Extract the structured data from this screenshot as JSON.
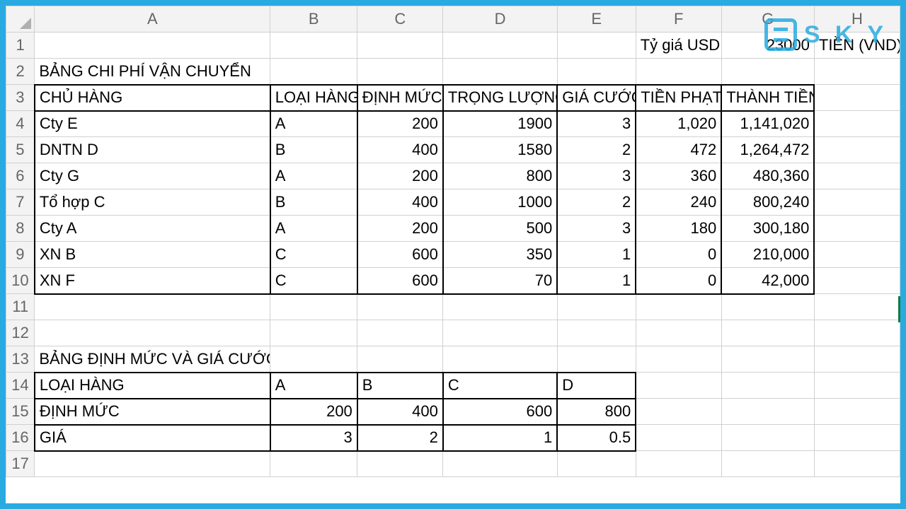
{
  "columns": [
    "A",
    "B",
    "C",
    "D",
    "E",
    "F",
    "G",
    "H"
  ],
  "row1": {
    "F": "Tỷ giá USD",
    "G": "23000",
    "H": "TIỀN (VND)"
  },
  "row2": {
    "A": "BẢNG CHI PHÍ VẬN CHUYỂN"
  },
  "headers3": [
    "CHỦ HÀNG",
    "LOẠI HÀNG",
    "ĐỊNH MỨC",
    "TRỌNG LƯỢNG",
    "GIÁ CƯỚC",
    "TIỀN PHẠT",
    "THÀNH TIỀN"
  ],
  "data": [
    {
      "n": "4",
      "chu": " Cty E",
      "loai": "A",
      "dm": "200",
      "tl": "1900",
      "gc": "3",
      "tp": "1,020",
      "tt": "1,141,020"
    },
    {
      "n": "5",
      "chu": " DNTN D",
      "loai": "B",
      "dm": "400",
      "tl": "1580",
      "gc": "2",
      "tp": "472",
      "tt": "1,264,472"
    },
    {
      "n": "6",
      "chu": " Cty G",
      "loai": "A",
      "dm": "200",
      "tl": "800",
      "gc": "3",
      "tp": "360",
      "tt": "480,360"
    },
    {
      "n": "7",
      "chu": " Tổ hợp C",
      "loai": "B",
      "dm": "400",
      "tl": "1000",
      "gc": "2",
      "tp": "240",
      "tt": "800,240"
    },
    {
      "n": "8",
      "chu": " Cty A",
      "loai": "A",
      "dm": "200",
      "tl": "500",
      "gc": "3",
      "tp": "180",
      "tt": "300,180"
    },
    {
      "n": "9",
      "chu": "XN B",
      "loai": "C",
      "dm": "600",
      "tl": "350",
      "gc": "1",
      "tp": "0",
      "tt": "210,000"
    },
    {
      "n": "10",
      "chu": "XN F",
      "loai": "C",
      "dm": "600",
      "tl": "70",
      "gc": "1",
      "tp": "0",
      "tt": "42,000"
    }
  ],
  "row13": {
    "A": "BẢNG ĐỊNH MỨC VÀ GIÁ CƯỚC"
  },
  "t2_headers": [
    "LOẠI HÀNG",
    "A",
    "B",
    "C",
    "D"
  ],
  "t2_dm": [
    "ĐỊNH MỨC",
    "200",
    "400",
    "600",
    "800"
  ],
  "t2_gia": [
    "GIÁ",
    "3",
    "2",
    "1",
    "0.5"
  ],
  "watermark": {
    "brand": "S K Y",
    "sub": "TIỀN (VND)"
  },
  "colwidths": {
    "rowhead": 40,
    "A": 330,
    "B": 122,
    "C": 120,
    "D": 160,
    "E": 110,
    "F": 120,
    "G": 130,
    "H": 120
  }
}
